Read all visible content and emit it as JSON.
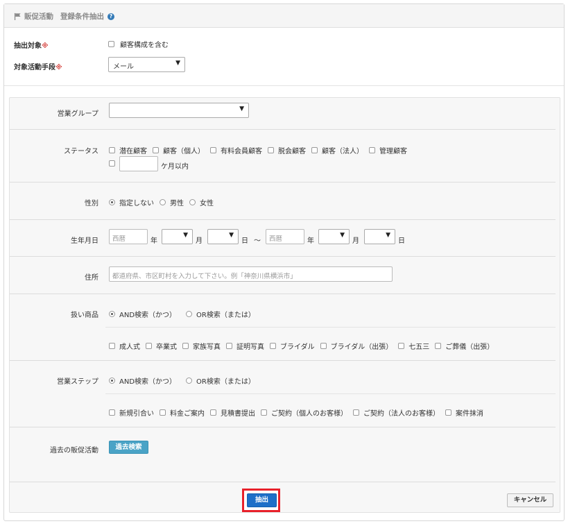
{
  "header": {
    "section": "販促活動",
    "title": "登録条件抽出"
  },
  "target": {
    "label": "抽出対象",
    "req": "※",
    "checkbox_label": "顧客構成を含む"
  },
  "method": {
    "label": "対象活動手段",
    "req": "※",
    "value": "メール"
  },
  "group": {
    "label": "営業グループ",
    "value": ""
  },
  "status": {
    "label": "ステータス",
    "options": [
      "潜在顧客",
      "顧客（個人）",
      "有料会員顧客",
      "脱会顧客",
      "顧客（法人）",
      "管理顧客"
    ],
    "months_suffix": "ケ月以内",
    "months_value": ""
  },
  "gender": {
    "label": "性別",
    "options": [
      "指定しない",
      "男性",
      "女性"
    ],
    "selected": "指定しない"
  },
  "birth": {
    "label": "生年月日",
    "year_placeholder": "西暦",
    "year_unit": "年",
    "month_unit": "月",
    "day_unit": "日",
    "tilde": "～"
  },
  "address": {
    "label": "住所",
    "placeholder": "都道府県、市区町村を入力して下さい。例「神奈川県横浜市」"
  },
  "products": {
    "label": "扱い商品",
    "modes": [
      "AND検索（かつ）",
      "OR検索（または）"
    ],
    "selected_mode": "AND検索（かつ）",
    "options": [
      "成人式",
      "卒業式",
      "家族写真",
      "証明写真",
      "ブライダル",
      "ブライダル（出張）",
      "七五三",
      "ご葬儀（出張）"
    ]
  },
  "steps": {
    "label": "営業ステップ",
    "modes": [
      "AND検索（かつ）",
      "OR検索（または）"
    ],
    "selected_mode": "AND検索（かつ）",
    "options": [
      "新規引合い",
      "料金ご案内",
      "見積書提出",
      "ご契約（個人のお客様）",
      "ご契約（法人のお客様）",
      "案件抹消"
    ]
  },
  "past": {
    "label": "過去の販促活動",
    "button": "過去検索"
  },
  "actions": {
    "extract": "抽出",
    "cancel": "キャンセル"
  },
  "colors": {
    "accent": "#1e6fc8",
    "highlight": "#e8202a",
    "search_button": "#4aa3c6",
    "required": "#d9534f"
  },
  "icons": [
    "flag-icon",
    "help-icon",
    "chevron-down-icon"
  ]
}
